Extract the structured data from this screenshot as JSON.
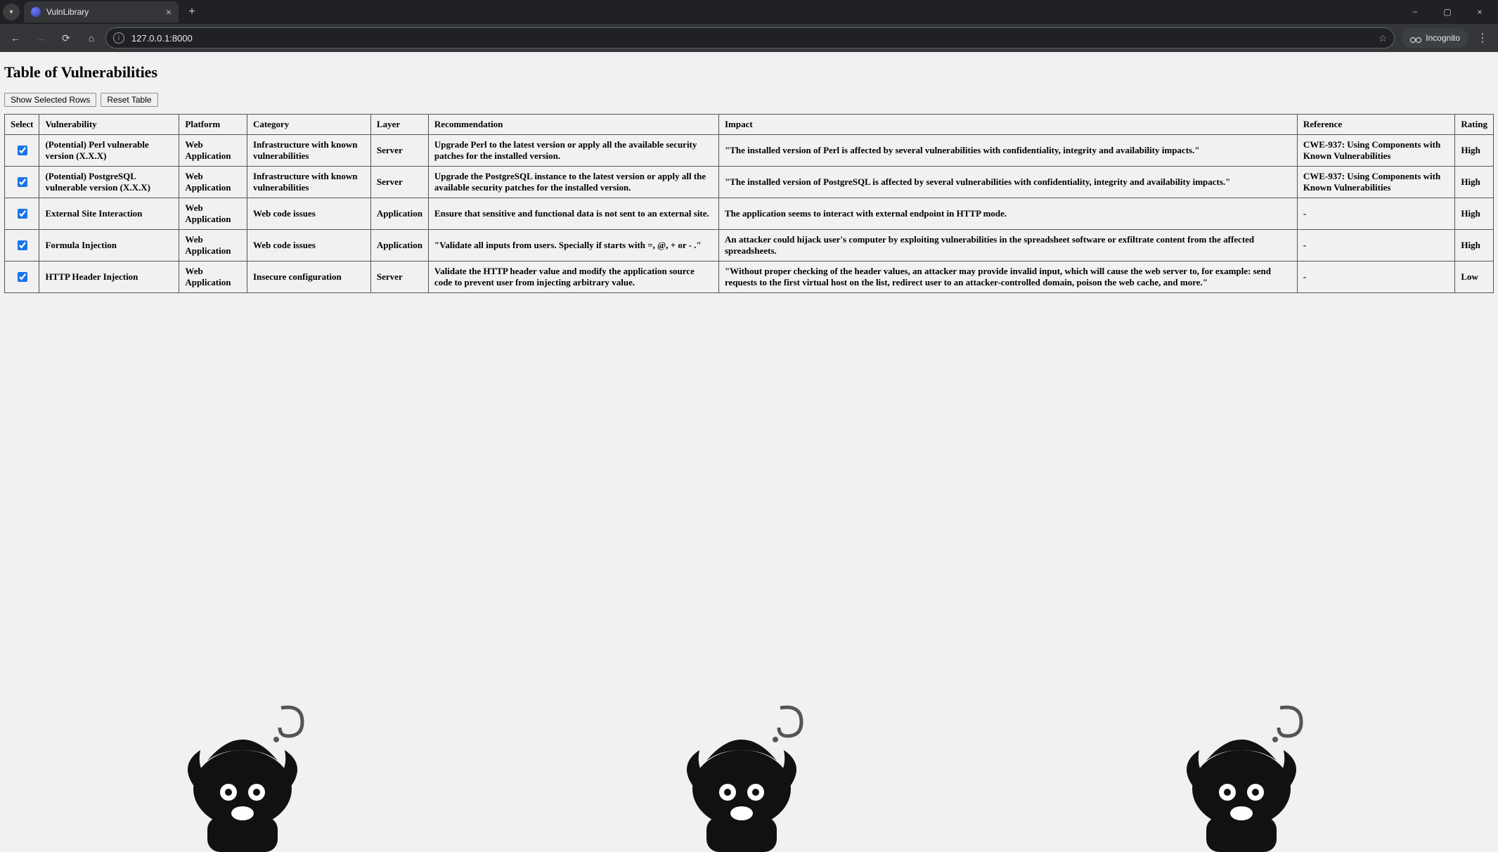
{
  "browser": {
    "tab_title": "VulnLibrary",
    "url": "127.0.0.1:8000",
    "incognito_label": "Incognito"
  },
  "page": {
    "heading": "Table of Vulnerabilities",
    "buttons": {
      "show_selected": "Show Selected Rows",
      "reset_table": "Reset Table"
    },
    "columns": [
      "Select",
      "Vulnerability",
      "Platform",
      "Category",
      "Layer",
      "Recommendation",
      "Impact",
      "Reference",
      "Rating"
    ],
    "rows": [
      {
        "selected": true,
        "vulnerability": "(Potential) Perl vulnerable version (X.X.X)",
        "platform": "Web Application",
        "category": "Infrastructure with known vulnerabilities",
        "layer": "Server",
        "recommendation": "Upgrade Perl to the latest version or apply all the available security patches for the installed version.",
        "impact": "\"The installed version of Perl is affected by several vulnerabilities with confidentiality, integrity and availability impacts.\"",
        "reference": "CWE-937: Using Components with Known Vulnerabilities",
        "rating": "High"
      },
      {
        "selected": true,
        "vulnerability": "(Potential) PostgreSQL vulnerable version (X.X.X)",
        "platform": "Web Application",
        "category": "Infrastructure with known vulnerabilities",
        "layer": "Server",
        "recommendation": "Upgrade the PostgreSQL instance to the latest version or apply all the available security patches for the installed version.",
        "impact": "\"The installed version of PostgreSQL is affected by several vulnerabilities with confidentiality, integrity and availability impacts.\"",
        "reference": "CWE-937: Using Components with Known Vulnerabilities",
        "rating": "High"
      },
      {
        "selected": true,
        "vulnerability": "External Site Interaction",
        "platform": "Web Application",
        "category": "Web code issues",
        "layer": "Application",
        "recommendation": "Ensure that sensitive and functional data is not sent to an external site.",
        "impact": "The application seems to interact with external endpoint in HTTP mode.",
        "reference": "-",
        "rating": "High"
      },
      {
        "selected": true,
        "vulnerability": "Formula Injection",
        "platform": "Web Application",
        "category": "Web code issues",
        "layer": "Application",
        "recommendation": "\"Validate all inputs from users. Specially if starts with =, @, + or - .\"",
        "impact": "An attacker could hijack user's computer by exploiting vulnerabilities in the spreadsheet software or exfiltrate content from the affected spreadsheets.",
        "reference": "-",
        "rating": "High"
      },
      {
        "selected": true,
        "vulnerability": "HTTP Header Injection",
        "platform": "Web Application",
        "category": "Insecure configuration",
        "layer": "Server",
        "recommendation": "Validate the HTTP header value and modify the application source code to prevent user from injecting arbitrary value.",
        "impact": "\"Without proper checking of the header values, an attacker may provide invalid input, which will cause the web server to, for example: send requests to the first virtual host on the list, redirect user to an attacker-controlled domain, poison the web cache, and more.\"",
        "reference": "-",
        "rating": "Low"
      }
    ]
  }
}
